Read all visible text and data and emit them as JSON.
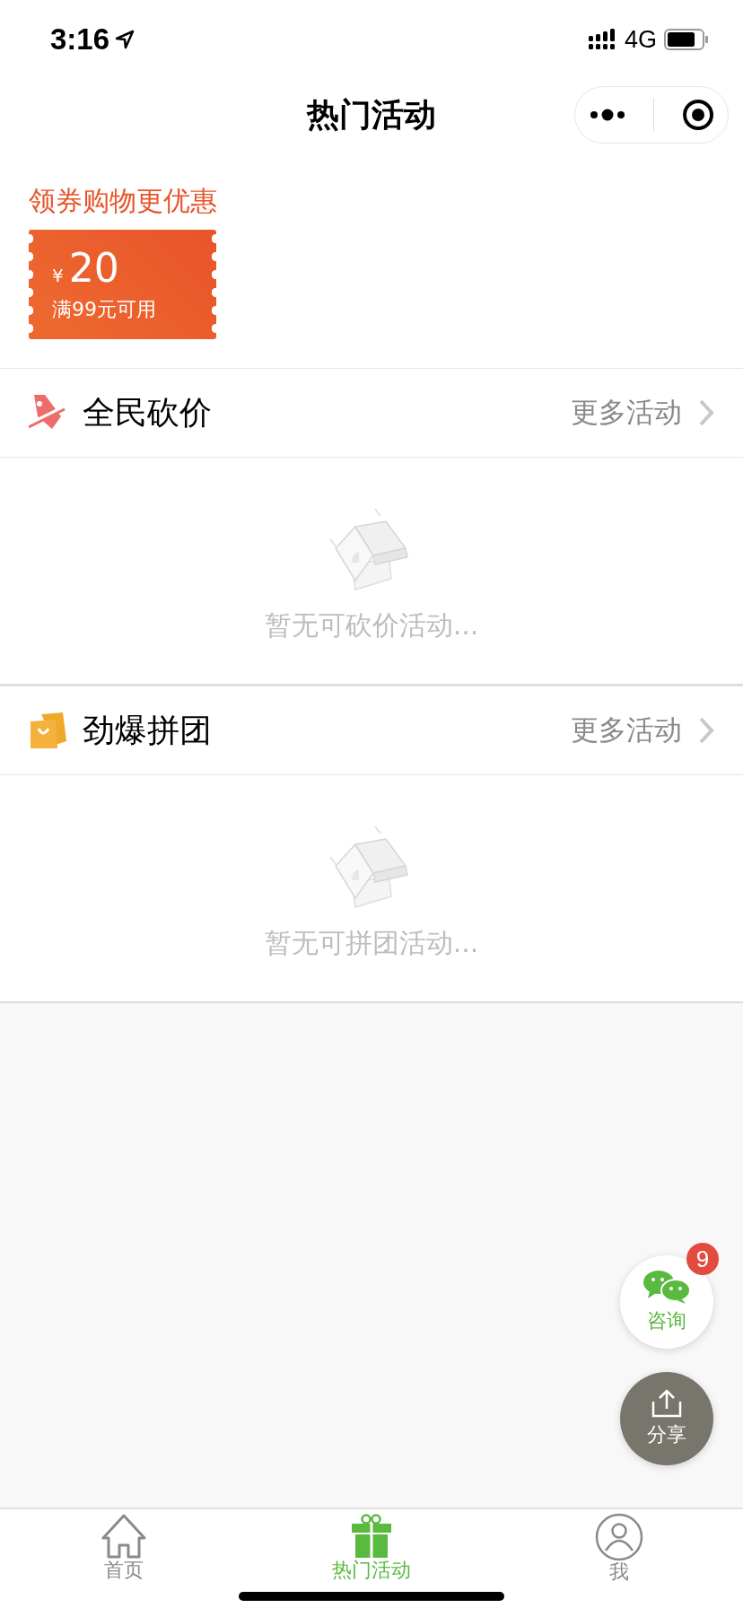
{
  "status_bar": {
    "time": "3:16",
    "network": "4G"
  },
  "nav": {
    "title": "热门活动"
  },
  "coupons": {
    "heading": "领券购物更优惠",
    "items": [
      {
        "currency": "¥",
        "amount": "20",
        "condition": "满99元可用"
      }
    ]
  },
  "sections": [
    {
      "kind": "bargain",
      "title": "全民砍价",
      "more": "更多活动",
      "empty_text": "暂无可砍价活动..."
    },
    {
      "kind": "group",
      "title": "劲爆拼团",
      "more": "更多活动",
      "empty_text": "暂无可拼团活动..."
    }
  ],
  "float_buttons": [
    {
      "kind": "consult",
      "label": "咨询",
      "badge": "9"
    },
    {
      "kind": "share",
      "label": "分享"
    }
  ],
  "tab_bar": [
    {
      "kind": "home",
      "label": "首页",
      "selected": false
    },
    {
      "kind": "gift",
      "label": "热门活动",
      "selected": true
    },
    {
      "kind": "user",
      "label": "我",
      "selected": false
    }
  ]
}
